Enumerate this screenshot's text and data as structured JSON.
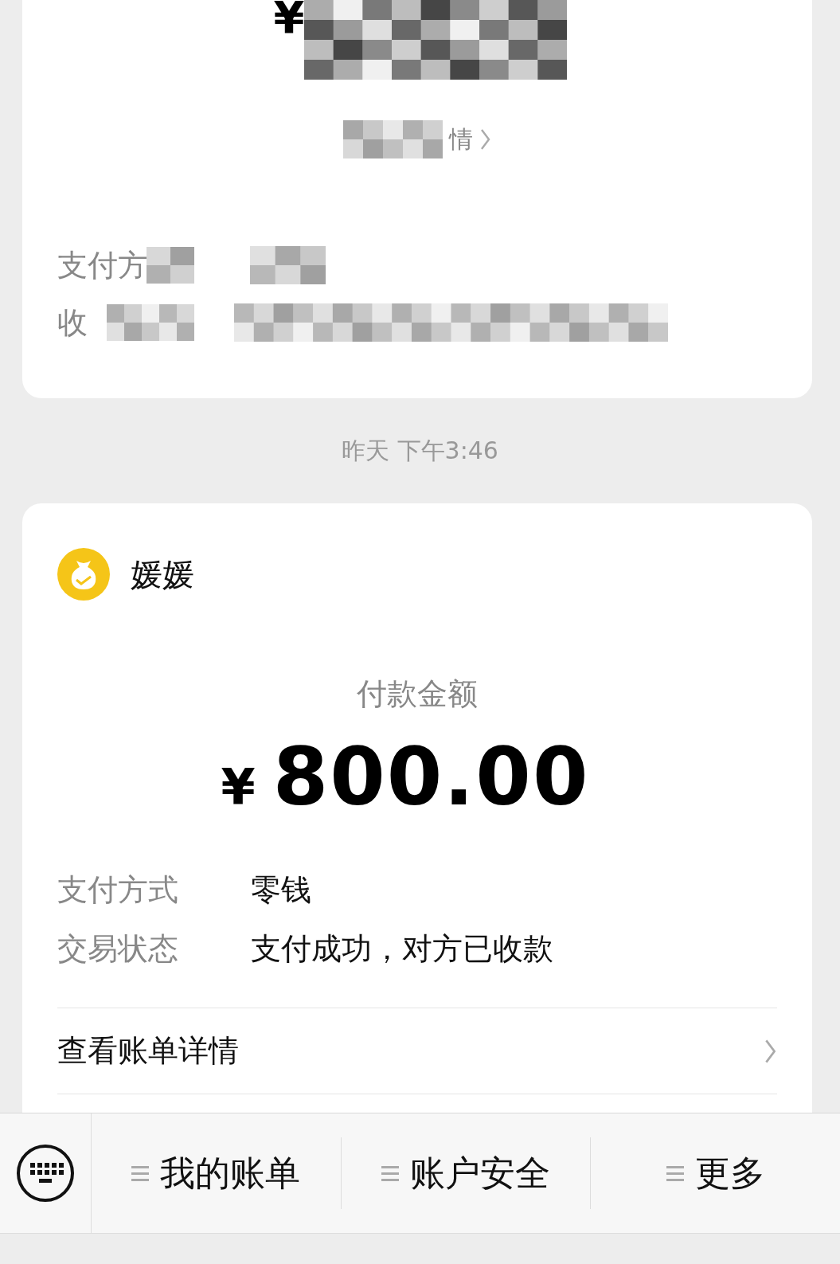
{
  "previous_card": {
    "amount_visible": "¥",
    "detail_link": "情",
    "rows": [
      {
        "label": "支付方"
      },
      {
        "label": "收"
      }
    ]
  },
  "timestamp": "昨天 下午3:46",
  "payment_card": {
    "merchant": "媛媛",
    "amount_label": "付款金额",
    "currency": "¥",
    "amount": "800.00",
    "rows": [
      {
        "label": "支付方式",
        "value": "零钱"
      },
      {
        "label": "交易状态",
        "value": "支付成功，对方已收款"
      }
    ],
    "detail_link": "查看账单详情"
  },
  "bottom_menu": {
    "items": [
      {
        "label": "我的账单"
      },
      {
        "label": "账户安全"
      },
      {
        "label": "更多"
      }
    ]
  }
}
